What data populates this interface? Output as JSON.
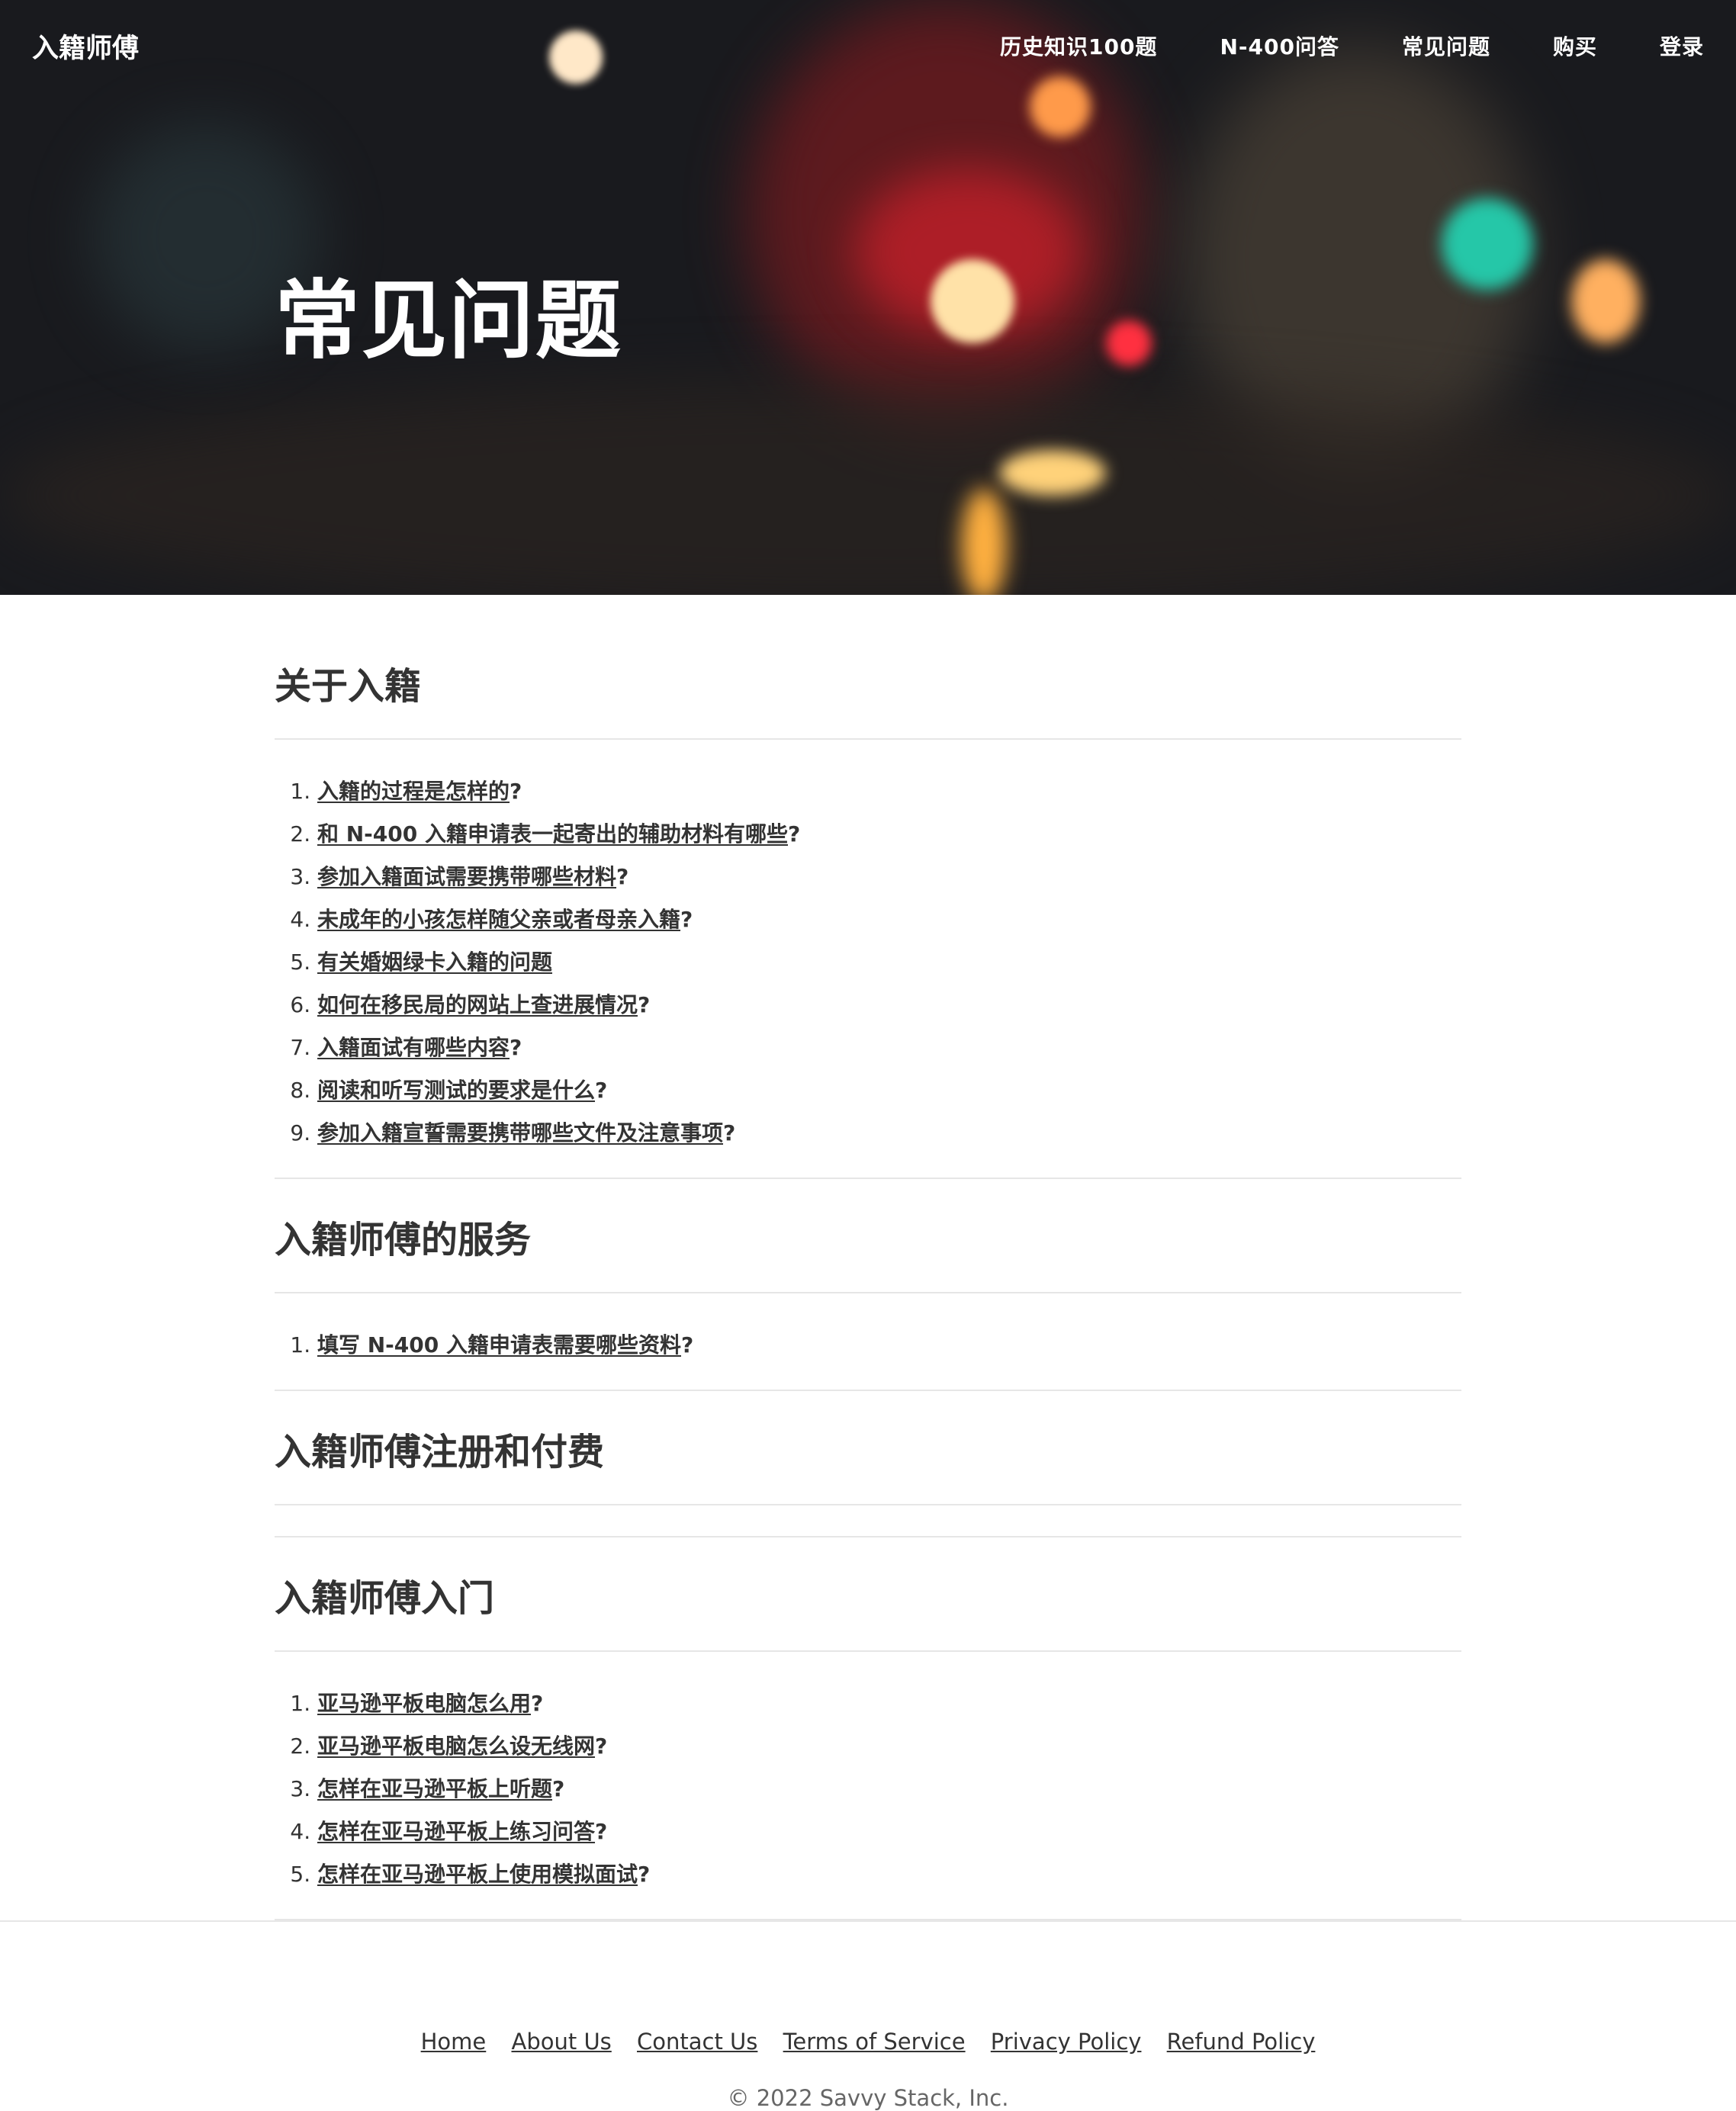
{
  "brand": "入籍师傅",
  "nav": {
    "items": [
      "历史知识100题",
      "N-400问答",
      "常见问题",
      "购买",
      "登录"
    ]
  },
  "hero": {
    "title": "常见问题"
  },
  "sections": [
    {
      "title": "关于入籍",
      "items": [
        "入籍的过程是怎样的",
        "和 N-400 入籍申请表一起寄出的辅助材料有哪些",
        "参加入籍面试需要携带哪些材料",
        "未成年的小孩怎样随父亲或者母亲入籍",
        "有关婚姻绿卡入籍的问题",
        "如何在移民局的网站上查进展情况",
        "入籍面试有哪些内容",
        "阅读和听写测试的要求是什么",
        "参加入籍宣誓需要携带哪些文件及注意事项"
      ],
      "suffixes": [
        "?",
        "?",
        "?",
        "?",
        "",
        "?",
        "?",
        "?",
        "?"
      ]
    },
    {
      "title": "入籍师傅的服务",
      "items": [
        "填写 N-400 入籍申请表需要哪些资料"
      ],
      "suffixes": [
        "?"
      ]
    },
    {
      "title": "入籍师傅注册和付费",
      "items": [],
      "suffixes": []
    },
    {
      "title": "入籍师傅入门",
      "items": [
        "亚马逊平板电脑怎么用",
        "亚马逊平板电脑怎么设无线网",
        "怎样在亚马逊平板上听题",
        "怎样在亚马逊平板上练习问答",
        "怎样在亚马逊平板上使用模拟面试"
      ],
      "suffixes": [
        "?",
        "?",
        "?",
        "?",
        "?"
      ]
    }
  ],
  "footer": {
    "links": [
      "Home",
      "About Us",
      "Contact Us",
      "Terms of Service",
      "Privacy Policy",
      "Refund Policy"
    ],
    "copyright": "© 2022 Savvy Stack, Inc."
  }
}
